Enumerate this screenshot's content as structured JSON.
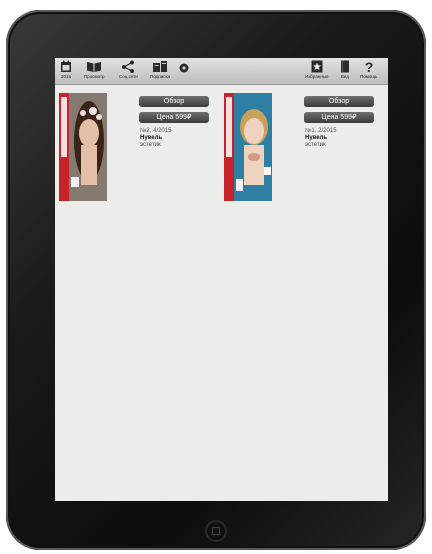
{
  "toolbar": {
    "left": [
      {
        "name": "toolbar-year",
        "label": "2015",
        "icon": "calendar-icon"
      },
      {
        "name": "toolbar-view",
        "label": "Просмотр",
        "icon": "open-book-icon"
      },
      {
        "name": "toolbar-social",
        "label": "Соц.сети",
        "icon": "share-icon"
      },
      {
        "name": "toolbar-subscription",
        "label": "Подписка",
        "icon": "subscription-icon"
      },
      {
        "name": "toolbar-settings",
        "label": "",
        "icon": "gear-icon"
      }
    ],
    "right": [
      {
        "name": "toolbar-favorites",
        "label": "Избранные",
        "icon": "star-icon"
      },
      {
        "name": "toolbar-view-mode",
        "label": "Вид",
        "icon": "book-icon"
      },
      {
        "name": "toolbar-help",
        "label": "Помощь",
        "icon": "help-icon"
      }
    ]
  },
  "issues": [
    {
      "review_label": "Обзор",
      "price_label": "Цена 599₽",
      "issue": "№2, 4/2015",
      "title": "Нувель",
      "category": "эстетик",
      "cover_colors": {
        "bg": "#8a8077",
        "spine": "#c8232a",
        "skin": "#e3bfa8",
        "hair": "#3a2418"
      }
    },
    {
      "review_label": "Обзор",
      "price_label": "Цена 599₽",
      "issue": "№1, 2/2015",
      "title": "Нувель",
      "category": "эстетик",
      "cover_colors": {
        "bg": "#2e7fa3",
        "spine": "#c8232a",
        "skin": "#efd2bf",
        "hair": "#c9a15a"
      }
    }
  ]
}
